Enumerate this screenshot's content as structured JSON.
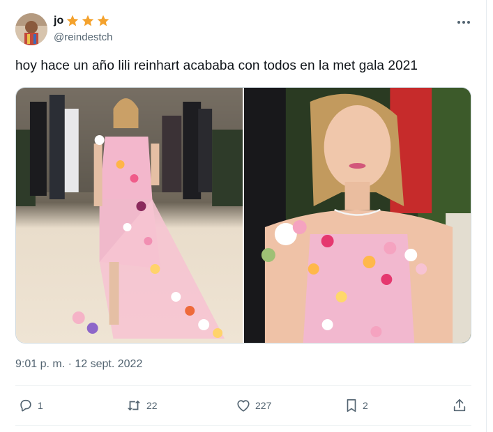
{
  "tweet": {
    "display_name": "jo",
    "name_emoji": "star-icons",
    "handle": "@reindestch",
    "text": "hoy hace un año lili reinhart acababa con todos en la met gala 2021",
    "timestamp": "9:01 p. m. · 12 sept. 2022"
  },
  "actions": {
    "replies": "1",
    "retweets": "22",
    "likes": "227",
    "bookmarks": "2"
  },
  "colors": {
    "text_primary": "#0f1419",
    "text_secondary": "#536471",
    "star": "#f4a22d",
    "border": "#cfd9de"
  },
  "media": {
    "count": 2,
    "photo_1": "full-length-photo",
    "photo_2": "close-up-photo"
  }
}
